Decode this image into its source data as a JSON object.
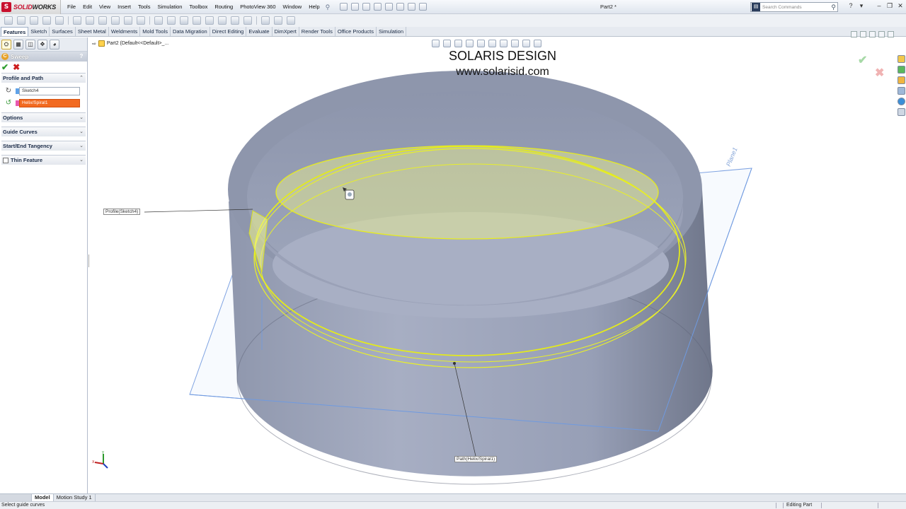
{
  "app": {
    "logo_mark": "S",
    "logo_text_a": "SOLID",
    "logo_text_b": "WORKS",
    "document_title": "Part2 *"
  },
  "menu": [
    "File",
    "Edit",
    "View",
    "Insert",
    "Tools",
    "Simulation",
    "Toolbox",
    "Routing",
    "PhotoView 360",
    "Window",
    "Help"
  ],
  "search": {
    "placeholder": "Search Commands"
  },
  "command_tabs": [
    "Features",
    "Sketch",
    "Surfaces",
    "Sheet Metal",
    "Weldments",
    "Mold Tools",
    "Data Migration",
    "Direct Editing",
    "Evaluate",
    "DimXpert",
    "Render Tools",
    "Office Products",
    "Simulation"
  ],
  "property_manager": {
    "title": "Sweep",
    "help": "?",
    "groups": {
      "profile_and_path": "Profile and Path",
      "options": "Options",
      "guide_curves": "Guide Curves",
      "tangency": "Start/End Tangency",
      "thin_feature": "Thin Feature"
    },
    "profile_value": "Sketch4",
    "path_value": "Helix/Spiral1"
  },
  "graphics": {
    "breadcrumb": "Part2  (Default<<Default>_...",
    "watermark_line1": "SOLARIS DESIGN",
    "watermark_line2": "www.solarisid.com",
    "profile_callout": "Profile(Sketch4)",
    "path_callout": "Path(Helix/Spiral1)",
    "plane_label": "Plane1"
  },
  "bottom_tabs": [
    "Model",
    "Motion Study 1"
  ],
  "status": {
    "message": "Select guide curves",
    "mode": "Editing Part"
  },
  "colors": {
    "body_fill": "#9da5bd",
    "helix_yellow": "#e8ef2a",
    "plane_blue": "#6f9ae0",
    "path_field": "#f26a21"
  }
}
